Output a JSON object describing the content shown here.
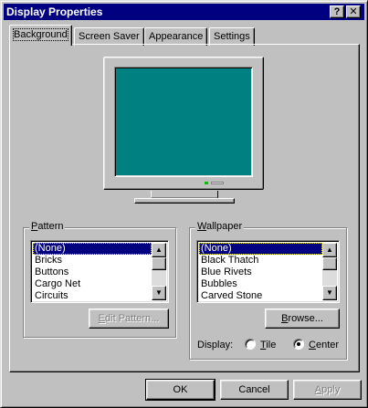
{
  "window": {
    "title": "Display Properties",
    "help_btn": "?",
    "close_btn": "✕"
  },
  "tabs": [
    {
      "label": "Background",
      "active": true
    },
    {
      "label": "Screen Saver",
      "active": false
    },
    {
      "label": "Appearance",
      "active": false
    },
    {
      "label": "Settings",
      "active": false
    }
  ],
  "monitor": {
    "screen_color": "#008080"
  },
  "pattern": {
    "label_access": "P",
    "label_rest": "attern",
    "items": [
      "(None)",
      "Bricks",
      "Buttons",
      "Cargo Net",
      "Circuits"
    ],
    "selected": "(None)",
    "edit_button_access": "E",
    "edit_button_rest": "dit Pattern..."
  },
  "wallpaper": {
    "label_access": "W",
    "label_rest": "allpaper",
    "items": [
      "(None)",
      "Black Thatch",
      "Blue Rivets",
      "Bubbles",
      "Carved Stone"
    ],
    "selected": "(None)",
    "browse_access": "B",
    "browse_rest": "rowse...",
    "display_label": "Display:",
    "tile_access": "T",
    "tile_rest": "ile",
    "center_access": "C",
    "center_rest": "enter",
    "display_mode": "Center"
  },
  "buttons": {
    "ok": "OK",
    "cancel": "Cancel",
    "apply_access": "A",
    "apply_rest": "pply"
  }
}
